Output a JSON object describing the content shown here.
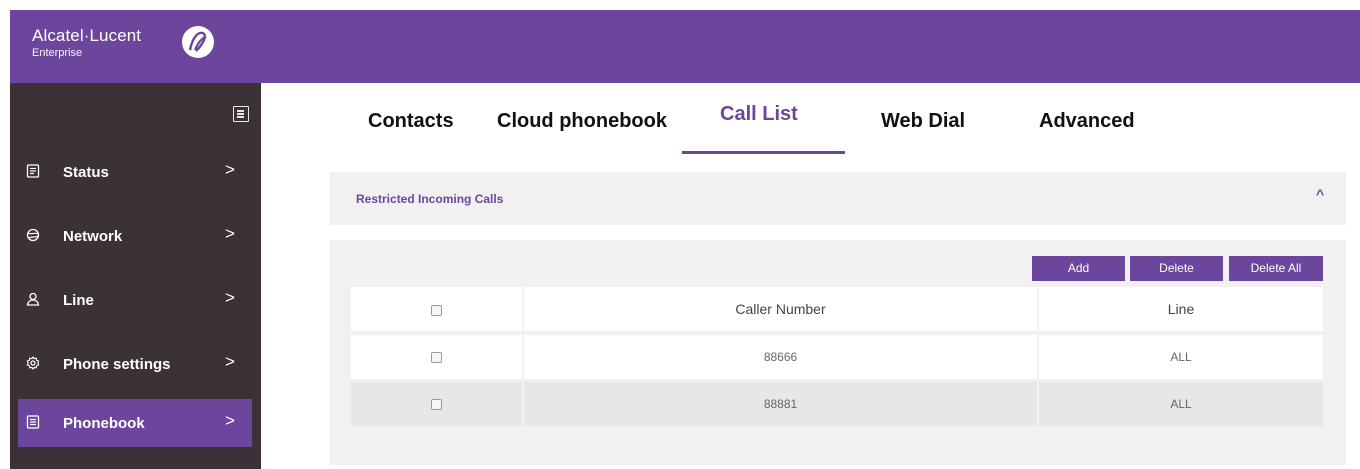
{
  "brand": {
    "name": "Alcatel·Lucent",
    "subtitle": "Enterprise"
  },
  "sidebar": {
    "items": [
      {
        "label": "Status",
        "icon": "status-icon"
      },
      {
        "label": "Network",
        "icon": "network-icon"
      },
      {
        "label": "Line",
        "icon": "user-icon"
      },
      {
        "label": "Phone settings",
        "icon": "settings-gear-icon"
      },
      {
        "label": "Phonebook",
        "icon": "phonebook-icon",
        "active": true
      }
    ]
  },
  "tabs": [
    {
      "label": "Contacts"
    },
    {
      "label": "Cloud phonebook"
    },
    {
      "label": "Call List",
      "active": true
    },
    {
      "label": "Web Dial"
    },
    {
      "label": "Advanced"
    }
  ],
  "section": {
    "title": "Restricted Incoming Calls",
    "caret": "^"
  },
  "toolbar": {
    "add": "Add",
    "delete": "Delete",
    "delete_all": "Delete All"
  },
  "table": {
    "columns": [
      "",
      "Caller Number",
      "Line"
    ],
    "rows": [
      {
        "number": "88666",
        "line": "ALL"
      },
      {
        "number": "88881",
        "line": "ALL"
      }
    ]
  },
  "colors": {
    "accent": "#6c469c",
    "sidebar_bg": "#3b3237",
    "panel_bg": "#f1f1f1"
  }
}
